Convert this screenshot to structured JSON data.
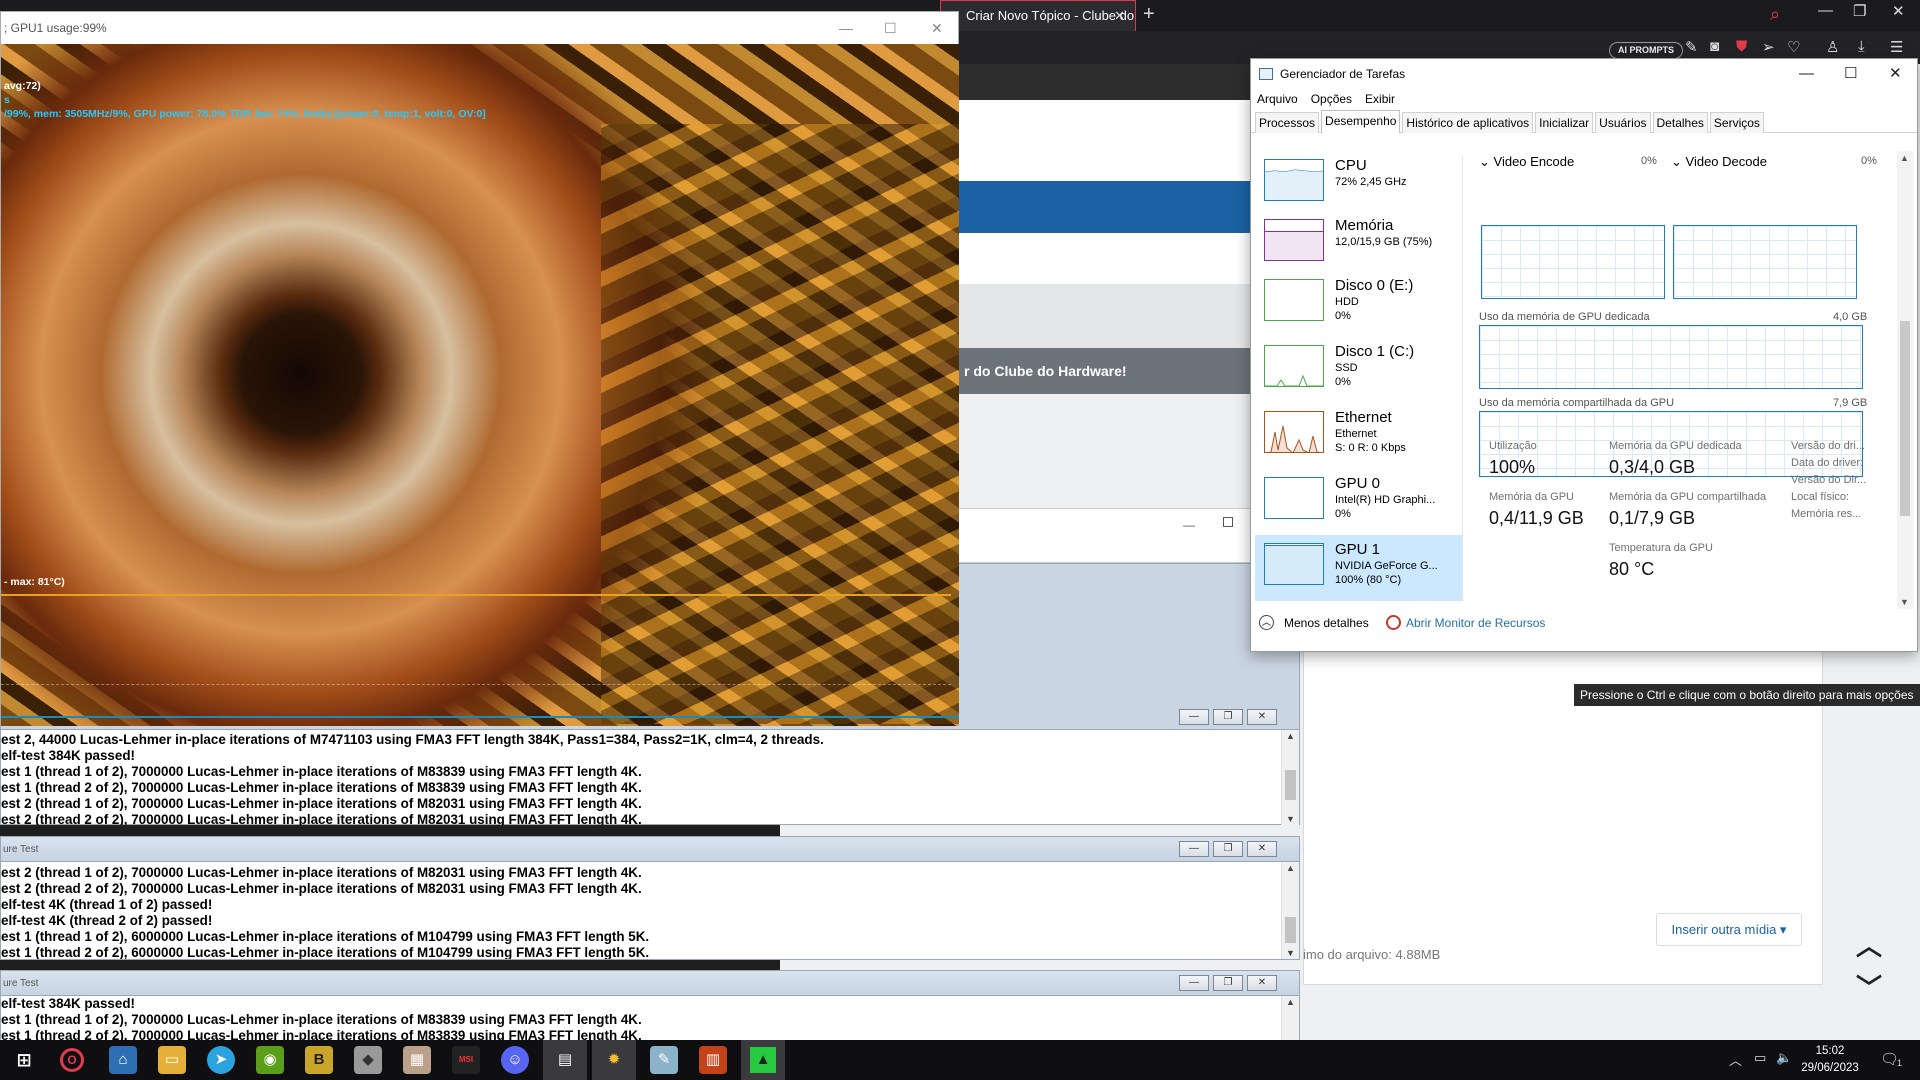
{
  "browser": {
    "active_tab_title": "Criar Novo Tópico - Clube do Hardware",
    "ai_prompts_label": "AI PROMPTS",
    "banner_text": "r do Clube do Hardware!",
    "insert_media_label": "Inserir outra mídia",
    "file_size_text": "imo do arquivo: 4.88MB",
    "tooltip": "Pressione o Ctrl e clique com o botão direito para mais opções"
  },
  "furmark": {
    "title": "; GPU1 usage:99%",
    "osd_lines": [
      "avg:72)",
      "s",
      "/99%, mem: 3505MHz/9%, GPU power: 78.0% TDP, fan: 74%, limits:[power:0, temp:1, volt:0, OV:0]",
      "- max: 81°C)"
    ]
  },
  "prime95": {
    "win1": {
      "lines": [
        "est 2, 44000 Lucas-Lehmer in-place iterations of M7471103 using FMA3 FFT length 384K, Pass1=384, Pass2=1K, clm=4, 2 threads.",
        "elf-test 384K passed!",
        "est 1 (thread 1 of 2), 7000000 Lucas-Lehmer in-place iterations of M83839 using FMA3 FFT length 4K.",
        "est 1 (thread 2 of 2), 7000000 Lucas-Lehmer in-place iterations of M83839 using FMA3 FFT length 4K.",
        "est 2 (thread 1 of 2), 7000000 Lucas-Lehmer in-place iterations of M82031 using FMA3 FFT length 4K.",
        "est 2 (thread 2 of 2), 7000000 Lucas-Lehmer in-place iterations of M82031 using FMA3 FFT length 4K."
      ]
    },
    "win2": {
      "title": "ure Test",
      "lines": [
        "est 2 (thread 1 of 2), 7000000 Lucas-Lehmer in-place iterations of M82031 using FMA3 FFT length 4K.",
        "est 2 (thread 2 of 2), 7000000 Lucas-Lehmer in-place iterations of M82031 using FMA3 FFT length 4K.",
        "elf-test 4K (thread 1 of 2) passed!",
        "elf-test 4K (thread 2 of 2) passed!",
        "est 1 (thread 1 of 2), 6000000 Lucas-Lehmer in-place iterations of M104799 using FMA3 FFT length 5K.",
        "est 1 (thread 2 of 2), 6000000 Lucas-Lehmer in-place iterations of M104799 using FMA3 FFT length 5K."
      ]
    },
    "win3": {
      "title": "ure Test",
      "lines": [
        "elf-test 384K passed!",
        "est 1 (thread 1 of 2), 7000000 Lucas-Lehmer in-place iterations of M83839 using FMA3 FFT length 4K.",
        "est 1 (thread 2 of 2), 7000000 Lucas-Lehmer in-place iterations of M83839 using FMA3 FFT length 4K."
      ]
    }
  },
  "taskmgr": {
    "title": "Gerenciador de Tarefas",
    "menu": [
      "Arquivo",
      "Opções",
      "Exibir"
    ],
    "tabs": [
      "Processos",
      "Desempenho",
      "Histórico de aplicativos",
      "Inicializar",
      "Usuários",
      "Detalhes",
      "Serviços"
    ],
    "active_tab": "Desempenho",
    "resources": [
      {
        "name": "CPU",
        "sub1": "72% 2,45 GHz",
        "sub2": "",
        "sub3": ""
      },
      {
        "name": "Memória",
        "sub1": "12,0/15,9 GB (75%)",
        "sub2": "",
        "sub3": ""
      },
      {
        "name": "Disco 0 (E:)",
        "sub1": "HDD",
        "sub2": "0%",
        "sub3": ""
      },
      {
        "name": "Disco 1 (C:)",
        "sub1": "SSD",
        "sub2": "0%",
        "sub3": ""
      },
      {
        "name": "Ethernet",
        "sub1": "Ethernet",
        "sub2": "S: 0 R: 0 Kbps",
        "sub3": ""
      },
      {
        "name": "GPU 0",
        "sub1": "Intel(R) HD Graphi...",
        "sub2": "0%",
        "sub3": ""
      },
      {
        "name": "GPU 1",
        "sub1": "NVIDIA GeForce G...",
        "sub2": "100% (80 °C)",
        "sub3": ""
      }
    ],
    "selected_resource": "GPU 1",
    "video_encode_label": "Video Encode",
    "video_encode_pct": "0%",
    "video_decode_label": "Video Decode",
    "video_decode_pct": "0%",
    "dedicated_label": "Uso da memória de GPU dedicada",
    "dedicated_max": "4,0 GB",
    "shared_label": "Uso da memória compartilhada da GPU",
    "shared_max": "7,9 GB",
    "stats": {
      "util_label": "Utilização",
      "util_value": "100%",
      "ded_label": "Memória da GPU dedicada",
      "ded_value": "0,3/4,0 GB",
      "gpu_mem_label": "Memória da GPU",
      "gpu_mem_value": "0,4/11,9 GB",
      "shared_label": "Memória da GPU compartilhada",
      "shared_value": "0,1/7,9 GB",
      "temp_label": "Temperatura da GPU",
      "temp_value": "80 °C",
      "driver_version": "Versão do dri...",
      "driver_date": "Data do driver:",
      "directx": "Versão do Dir...",
      "location": "Local físico:",
      "reserved": "Memória res..."
    },
    "fewer_details": "Menos detalhes",
    "open_resmon": "Abrir Monitor de Recursos"
  },
  "taskbar": {
    "time": "15:02",
    "date": "29/06/2023",
    "notification_count": "1"
  },
  "colors": {
    "accent_blue": "#1d7fbd",
    "opera_red": "#e23b4b",
    "page_blue": "#1a62a3"
  }
}
